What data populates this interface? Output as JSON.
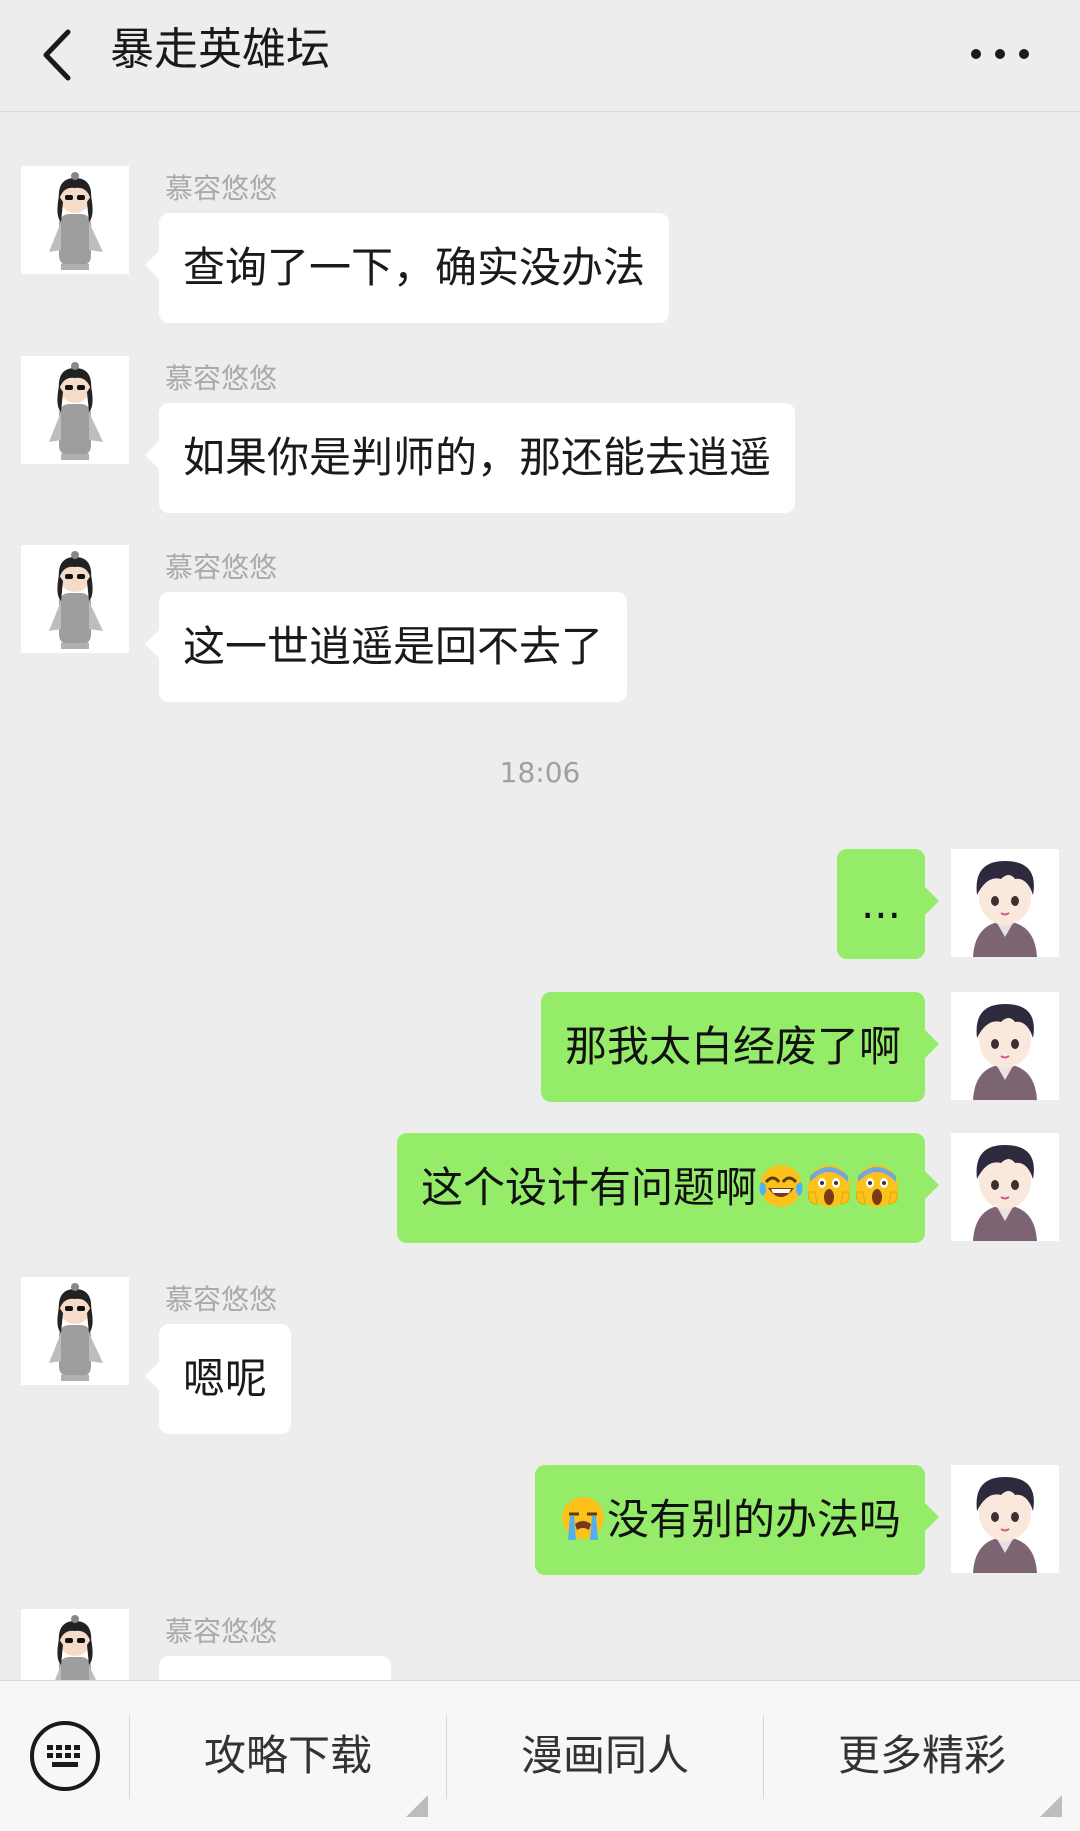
{
  "header": {
    "title": "暴走英雄坛",
    "back_icon": "chevron-left-icon",
    "more_icon": "more-dots-icon"
  },
  "contact": {
    "name": "慕容悠悠"
  },
  "messages": [
    {
      "from": "other",
      "sender": "慕容悠悠",
      "text": "查询了一下，确实没办法"
    },
    {
      "from": "other",
      "sender": "慕容悠悠",
      "text": "如果你是判师的，那还能去逍遥"
    },
    {
      "from": "other",
      "sender": "慕容悠悠",
      "text": "这一世逍遥是回不去了"
    },
    {
      "type": "timestamp",
      "text": "18:06"
    },
    {
      "from": "me",
      "text": "..."
    },
    {
      "from": "me",
      "text": "那我太白经废了啊"
    },
    {
      "from": "me",
      "text": "这个设计有问题啊",
      "emojis": [
        "tears-of-joy-emoji",
        "screaming-emoji",
        "screaming-emoji"
      ]
    },
    {
      "from": "other",
      "sender": "慕容悠悠",
      "text": "嗯呢"
    },
    {
      "from": "me",
      "text": "没有别的办法吗",
      "leading_emoji": "loudly-crying-emoji"
    },
    {
      "from": "other",
      "sender": "慕容悠悠",
      "text": ""
    }
  ],
  "bottom_menu": {
    "keyboard_icon": "keyboard-icon",
    "items": [
      {
        "label": "攻略下载"
      },
      {
        "label": "漫画同人"
      },
      {
        "label": "更多精彩"
      }
    ]
  },
  "colors": {
    "background": "#ededed",
    "outgoing_bubble": "#95ec69",
    "incoming_bubble": "#ffffff"
  }
}
